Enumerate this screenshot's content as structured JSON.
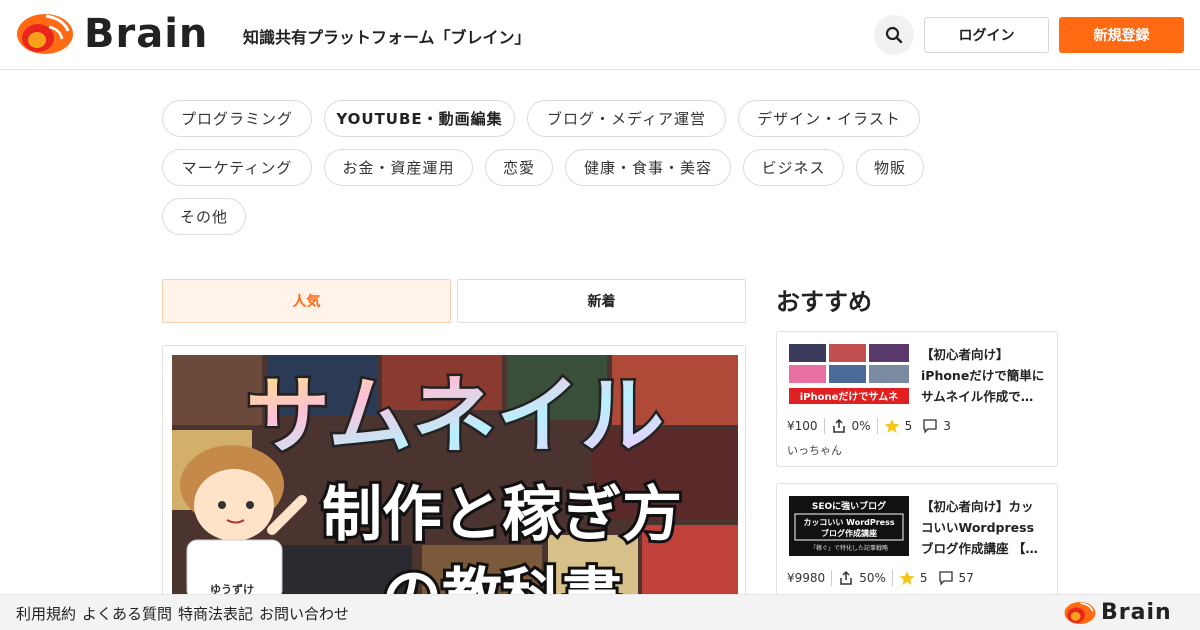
{
  "header": {
    "logo_text": "Brain",
    "tagline": "知識共有プラットフォーム「ブレイン」",
    "login_label": "ログイン",
    "signup_label": "新規登録",
    "accent_color": "#ff6a13"
  },
  "categories": [
    {
      "label": "プログラミング"
    },
    {
      "label": "YOUTUBE・動画編集"
    },
    {
      "label": "ブログ・メディア運営"
    },
    {
      "label": "デザイン・イラスト"
    },
    {
      "label": "マーケティング"
    },
    {
      "label": "お金・資産運用"
    },
    {
      "label": "恋愛"
    },
    {
      "label": "健康・食事・美容"
    },
    {
      "label": "ビジネス"
    },
    {
      "label": "物販"
    },
    {
      "label": "その他"
    }
  ],
  "tabs": {
    "popular": "人気",
    "new": "新着"
  },
  "featured": {
    "thumb_line1": "サムネイル",
    "thumb_line2": "制作と稼ぎ方",
    "thumb_line3": "の教科書",
    "char_label": "ゆうずけ"
  },
  "recommended": {
    "title": "おすすめ",
    "items": [
      {
        "title": "【初心者向け】iPhoneだけで簡単にサムネイル作成で…",
        "thumb_text": "iPhoneだけでサムネ",
        "price": "¥100",
        "affiliate": "0%",
        "rating": "5",
        "comments": "3",
        "author": "いっちゃん"
      },
      {
        "title": "【初心者向け】カッコいいWordpressブログ作成講座 【…",
        "thumb_text1": "SEOに強いブログ",
        "thumb_text2": "カッコいい WordPress",
        "thumb_text3": "ブログ作成講座",
        "thumb_text4": "「稼ぐ」で特化した記事戦略",
        "price": "¥9980",
        "affiliate": "50%",
        "rating": "5",
        "comments": "57"
      }
    ]
  },
  "footer": {
    "links": [
      "利用規約",
      "よくある質問",
      "特商法表記",
      "お問い合わせ"
    ],
    "logo_text": "Brain"
  }
}
